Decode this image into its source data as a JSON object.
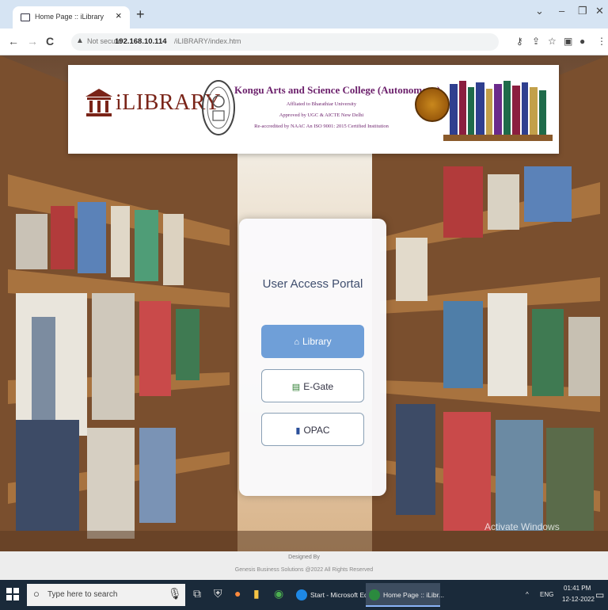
{
  "browser": {
    "tab_title": "Home Page :: iLibrary",
    "tab_close": "×",
    "new_tab": "+",
    "win_minimize": "–",
    "win_restore": "❐",
    "win_close": "✕",
    "address_warning": "Not secure",
    "address_host": "192.168.10.114",
    "address_path": "/iLIBRARY/index.htm"
  },
  "banner": {
    "brand": "iLIBRARY",
    "college": "Kongu Arts and Science College (Autonomous)",
    "line1": "Affliated to Bharathiar University",
    "line2": "Approved by UGC & AICTE New Delhi",
    "line3": "Re-accredited by NAAC   An ISO 9001: 2015 Certified Institution"
  },
  "portal": {
    "heading": "User Access Portal",
    "buttons": [
      {
        "label": "Library",
        "icon": "home-icon"
      },
      {
        "label": "E-Gate",
        "icon": "id-card-icon"
      },
      {
        "label": "OPAC",
        "icon": "book-icon"
      }
    ]
  },
  "watermark": "Activate Windows",
  "footer": {
    "designed_by": "Designed By",
    "credit": "Genesis Business Solutions @2022 All Rights Reserved"
  },
  "taskbar": {
    "search_placeholder": "Type here to search",
    "app1": "Start - Microsoft Ed",
    "app2": "Home Page :: iLibr...",
    "lang": "ENG",
    "time": "01:41 PM",
    "date": "12-12-2022"
  },
  "colors": {
    "primary_button": "#6f9fd8",
    "heading": "#3f4e6e",
    "brand": "#7a2418",
    "college": "#6b1f6b",
    "taskbar": "#1a2a3a"
  }
}
